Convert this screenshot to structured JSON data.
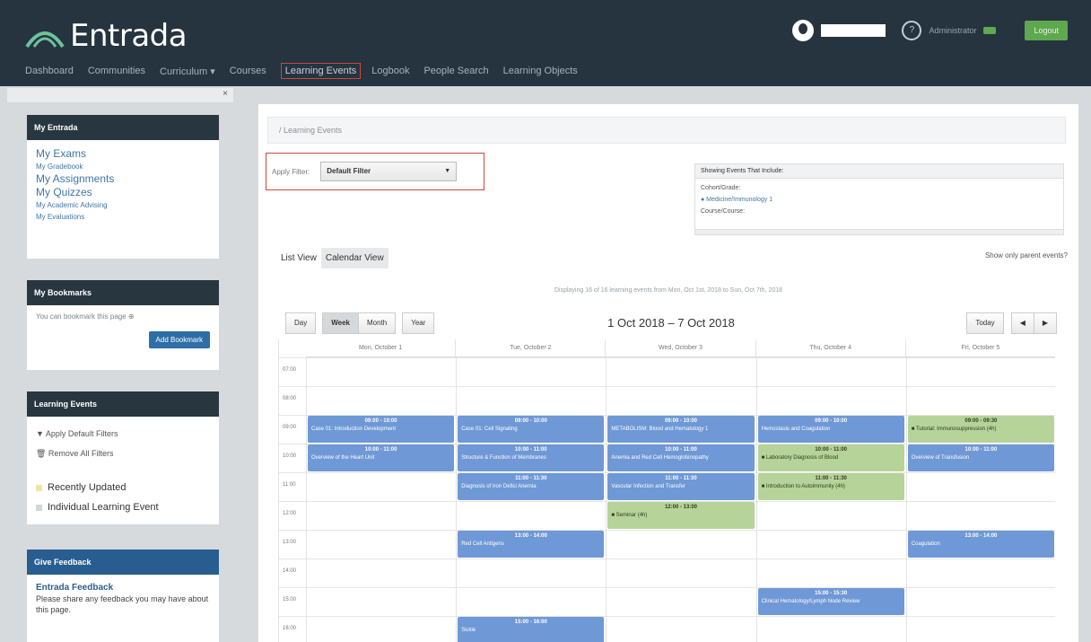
{
  "header": {
    "logo_text": "Entrada",
    "role_text": "Administrator",
    "logout_label": "Logout",
    "nav": [
      "Dashboard",
      "Communities",
      "Curriculum ▾",
      "Courses",
      "Learning Events",
      "Logbook",
      "People Search",
      "Learning Objects"
    ]
  },
  "sidebar": {
    "entrada": {
      "title": "My Entrada",
      "links": [
        {
          "label": "My Exams",
          "size": "lg"
        },
        {
          "label": "My Gradebook",
          "size": "sm"
        },
        {
          "label": "My Assignments",
          "size": "lg"
        },
        {
          "label": "My Quizzes",
          "size": "lg"
        },
        {
          "label": "My Academic Advising",
          "size": "sm"
        },
        {
          "label": "My Evaluations",
          "size": "sm"
        }
      ]
    },
    "bookmarks": {
      "title": "My Bookmarks",
      "hint": "You can bookmark this page ⊕",
      "button": "Add Bookmark"
    },
    "learning": {
      "title": "Learning Events",
      "apply": "▼ Apply Default Filters",
      "remove": "🗑 Remove All Filters",
      "legend": [
        {
          "label": "Recently Updated",
          "color": "#f2e5a0"
        },
        {
          "label": "Individual Learning Event",
          "color": "#cfd8de"
        }
      ]
    },
    "feedback": {
      "title": "Give Feedback",
      "heading": "Entrada Feedback",
      "text": "Please share any feedback you may have about this page."
    }
  },
  "main": {
    "crumb": "/ Learning Events",
    "filter_label": "Apply Filter:",
    "filter_value": "Default Filter",
    "showing_title": "Showing Events That Include:",
    "showing_group": "Cohort/Grade:",
    "showing_item": "● Medicine/Immunology 1",
    "showing_sub": "Course/Course:",
    "tabs": [
      "List View",
      "Calendar View"
    ],
    "parent_only": "Show only parent events?",
    "displaying": "Displaying 16 of 16 learning events from Mon, Oct 1st, 2018 to Sun, Oct 7th, 2018",
    "views": [
      "Day",
      "Week",
      "Month",
      "Year"
    ],
    "date_range": "1 Oct 2018 – 7 Oct 2018",
    "today_label": "Today",
    "prev_icon": "◀",
    "next_icon": "▶"
  },
  "calendar": {
    "days": [
      "Mon, October 1",
      "Tue, October 2",
      "Wed, October 3",
      "Thu, October 4",
      "Fri, October 5"
    ],
    "times": [
      "07:00",
      "08:00",
      "09:00",
      "10:00",
      "11:00",
      "12:00",
      "13:00",
      "14:00",
      "15:00",
      "16:00"
    ],
    "events": [
      {
        "day": 0,
        "start": 9,
        "end": 10,
        "color": "blue",
        "time": "09:00 - 10:00",
        "name": "Case 01: Introduction Development"
      },
      {
        "day": 0,
        "start": 10,
        "end": 11,
        "color": "blue",
        "time": "10:00 - 11:00",
        "name": "Overview of the Heart Unit"
      },
      {
        "day": 1,
        "start": 9,
        "end": 10,
        "color": "blue",
        "time": "09:00 - 10:00",
        "name": "Case 01: Cell Signaling"
      },
      {
        "day": 1,
        "start": 10,
        "end": 11,
        "color": "blue",
        "time": "10:00 - 11:00",
        "name": "Structure & Function of Membranes"
      },
      {
        "day": 1,
        "start": 11,
        "end": 12,
        "color": "blue",
        "time": "11:00 - 11:30",
        "name": "Diagnosis of Iron Defici Anemia"
      },
      {
        "day": 1,
        "start": 13,
        "end": 14,
        "color": "blue",
        "time": "13:00 - 14:00",
        "name": "Red Cell Antigens"
      },
      {
        "day": 1,
        "start": 16,
        "end": 17,
        "color": "blue",
        "time": "15:00 - 16:00",
        "name": "Sickle"
      },
      {
        "day": 2,
        "start": 9,
        "end": 10,
        "color": "blue",
        "time": "09:00 - 10:00",
        "name": "METABOLISM: Blood and Hematology 1"
      },
      {
        "day": 2,
        "start": 10,
        "end": 11,
        "color": "blue",
        "time": "10:00 - 11:00",
        "name": "Anemia and Red Cell Hemoglobinopathy"
      },
      {
        "day": 2,
        "start": 11,
        "end": 12,
        "color": "blue",
        "time": "11:00 - 11:30",
        "name": "Vascular Infection and Transfer"
      },
      {
        "day": 2,
        "start": 12,
        "end": 13,
        "color": "green",
        "time": "12:00 - 13:00",
        "name": "■ Seminar (4h)"
      },
      {
        "day": 3,
        "start": 9,
        "end": 10,
        "color": "blue",
        "time": "09:00 - 10:00",
        "name": "Hemostasis and Coagulation"
      },
      {
        "day": 3,
        "start": 10,
        "end": 11,
        "color": "green",
        "time": "10:00 - 11:00",
        "name": "■ Laboratory Diagnosis of Blood"
      },
      {
        "day": 3,
        "start": 11,
        "end": 12,
        "color": "green",
        "time": "11:00 - 11:30",
        "name": "■ Introduction to Autoimmunity (4h)"
      },
      {
        "day": 3,
        "start": 15,
        "end": 16,
        "color": "blue",
        "time": "15:00 - 15:30",
        "name": "Clinical Hematology/Lymph Node Review"
      },
      {
        "day": 4,
        "start": 9,
        "end": 10,
        "color": "green",
        "time": "09:00 - 09:30",
        "name": "■ Tutorial: Immunosuppression (4h)"
      },
      {
        "day": 4,
        "start": 10,
        "end": 11,
        "color": "blue",
        "time": "10:00 - 11:00",
        "name": "Overview of Transfusion"
      },
      {
        "day": 4,
        "start": 13,
        "end": 14,
        "color": "blue",
        "time": "13:00 - 14:00",
        "name": "Coagulation"
      }
    ]
  }
}
